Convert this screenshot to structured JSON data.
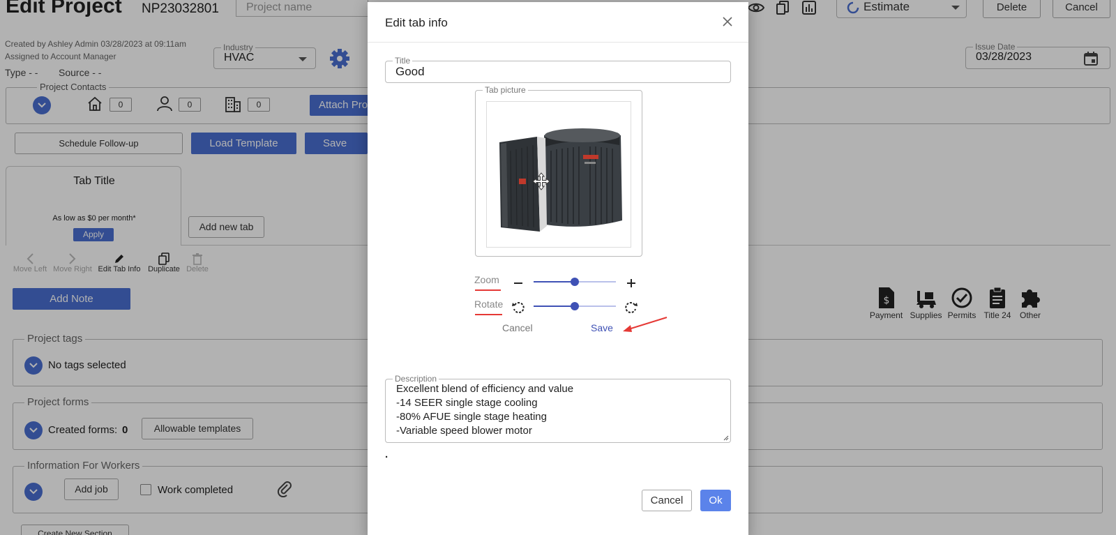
{
  "page": {
    "title": "Edit Project",
    "project_number": "NP23032801",
    "project_name_placeholder": "Project name",
    "created_by": "Created by Ashley Admin 03/28/2023 at 09:11am",
    "assigned_to": "Assigned to Account Manager",
    "type_label": "Type - -",
    "source_label": "Source - -",
    "industry_label": "Industry",
    "industry_value": "HVAC",
    "status_value": "Estimate",
    "delete_label": "Delete",
    "cancel_label": "Cancel",
    "issue_date_label": "Issue Date",
    "issue_date_value": "03/28/2023"
  },
  "contacts": {
    "legend": "Project Contacts",
    "home_count": "0",
    "person_count": "0",
    "building_count": "0",
    "attach_label": "Attach Pro"
  },
  "actions": {
    "schedule": "Schedule Follow-up",
    "load_template": "Load Template",
    "save_template": "Save Tem"
  },
  "tab_card": {
    "title": "Tab Title",
    "promo": "As low as $0 per month*",
    "apply": "Apply",
    "add_new_tab": "Add new tab"
  },
  "tab_tools": {
    "move_left": "Move Left",
    "move_right": "Move Right",
    "edit_info": "Edit Tab Info",
    "duplicate": "Duplicate",
    "delete": "Delete"
  },
  "add_note": "Add Note",
  "right_tools": {
    "payment": "Payment",
    "supplies": "Supplies",
    "permits": "Permits",
    "title24": "Title 24",
    "other": "Other"
  },
  "sections": {
    "tags_legend": "Project tags",
    "tags_value": "No tags selected",
    "forms_legend": "Project forms",
    "forms_created_label": "Created forms:",
    "forms_created_count": "0",
    "allowable_templates": "Allowable templates",
    "workers_legend": "Information For Workers",
    "add_job": "Add job",
    "work_completed": "Work completed",
    "create_new_section": "Create New Section"
  },
  "modal": {
    "title": "Edit tab info",
    "title_field_label": "Title",
    "title_field_value": "Good",
    "tab_picture_label": "Tab picture",
    "zoom_label": "Zoom",
    "rotate_label": "Rotate",
    "zoom_level": 0.5,
    "rotate_level": 0.5,
    "crop_cancel": "Cancel",
    "crop_save": "Save",
    "description_label": "Description",
    "description_value": "Excellent blend of efficiency and value\n-14 SEER single stage cooling\n-80% AFUE single stage heating\n-Variable speed blower motor",
    "dot_text": ".",
    "cancel": "Cancel",
    "ok": "Ok"
  },
  "colors": {
    "primary": "#4a6fd1",
    "slider": "#3f51b5",
    "ok_button": "#5b83ea",
    "annotation_red": "#e53935"
  }
}
